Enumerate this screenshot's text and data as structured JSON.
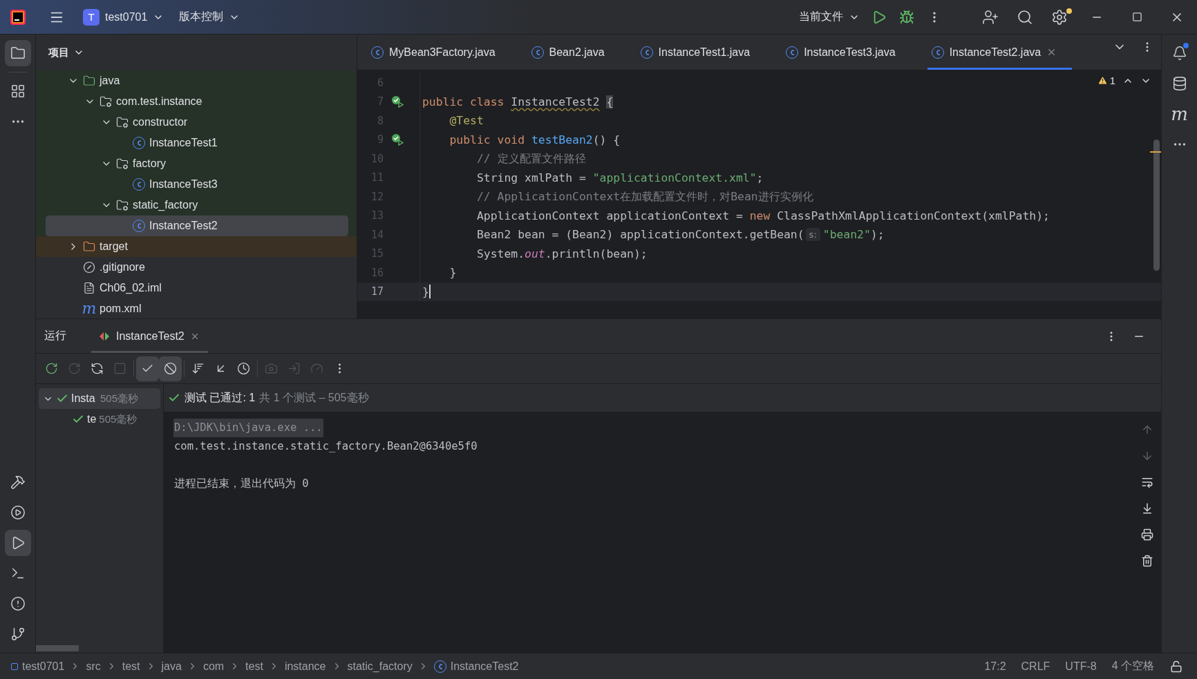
{
  "title_bar": {
    "project_initial": "T",
    "project": "test0701",
    "vcs": "版本控制",
    "run_config": "当前文件"
  },
  "left_tools": [
    {
      "kind": "project",
      "selected": true
    },
    {
      "kind": "structure",
      "selected": false
    },
    {
      "kind": "more",
      "selected": false
    }
  ],
  "left_tools_bottom": [
    {
      "kind": "build",
      "selected": false
    },
    {
      "kind": "services",
      "selected": false
    },
    {
      "kind": "run",
      "selected": true
    },
    {
      "kind": "terminal",
      "selected": false
    },
    {
      "kind": "problems",
      "selected": false
    },
    {
      "kind": "git",
      "selected": false
    }
  ],
  "right_tools": [
    {
      "kind": "notifications",
      "badge": true
    },
    {
      "kind": "database",
      "badge": false
    },
    {
      "kind": "maven",
      "label": "m",
      "badge": false
    },
    {
      "kind": "more",
      "badge": false
    }
  ],
  "project_panel": {
    "title": "项目",
    "tree": [
      {
        "name": "java",
        "kind": "test_folder",
        "expanded": true,
        "selected": false,
        "children": [
          {
            "name": "com.test.instance",
            "kind": "package",
            "expanded": true,
            "selected": false,
            "children": [
              {
                "name": "constructor",
                "kind": "package",
                "expanded": true,
                "selected": false,
                "children": [
                  {
                    "name": "InstanceTest1",
                    "kind": "class",
                    "selected": false
                  }
                ]
              },
              {
                "name": "factory",
                "kind": "package",
                "expanded": true,
                "selected": false,
                "children": [
                  {
                    "name": "InstanceTest3",
                    "kind": "class",
                    "selected": false
                  }
                ]
              },
              {
                "name": "static_factory",
                "kind": "package",
                "expanded": true,
                "selected": false,
                "children": [
                  {
                    "name": "InstanceTest2",
                    "kind": "class",
                    "selected": true
                  }
                ]
              }
            ]
          }
        ]
      },
      {
        "name": "target",
        "kind": "excluded_folder",
        "expanded": false,
        "selected": false
      },
      {
        "name": ".gitignore",
        "kind": "ignore_file",
        "selected": false
      },
      {
        "name": "Ch06_02.iml",
        "kind": "module_file",
        "selected": false
      },
      {
        "name": "pom.xml",
        "kind": "maven_file",
        "icon_label": "m",
        "selected": false
      }
    ]
  },
  "editor": {
    "tabs": [
      {
        "label": "MyBean3Factory.java",
        "selected": false,
        "closable": false
      },
      {
        "label": "Bean2.java",
        "selected": false,
        "closable": false
      },
      {
        "label": "InstanceTest1.java",
        "selected": false,
        "closable": false
      },
      {
        "label": "InstanceTest3.java",
        "selected": false,
        "closable": false
      },
      {
        "label": "InstanceTest2.java",
        "selected": true,
        "closable": true
      }
    ],
    "warnings": "1",
    "lines": [
      {
        "number": "6",
        "run": false,
        "current": false
      },
      {
        "number": "7",
        "run": true,
        "current": false,
        "segments": [
          {
            "kind": "keyword",
            "text": "public class "
          },
          {
            "kind": "class_name",
            "text": "InstanceTest2"
          },
          {
            "kind": "brace_match",
            "text": "{"
          }
        ]
      },
      {
        "number": "8",
        "run": false,
        "current": false,
        "segments": [
          {
            "kind": "annotation",
            "text": "    @Test"
          }
        ]
      },
      {
        "number": "9",
        "run": true,
        "current": false,
        "segments": [
          {
            "kind": "keyword",
            "text": "    public void "
          },
          {
            "kind": "method",
            "text": "testBean2"
          },
          {
            "kind": "plain",
            "text": "() {"
          }
        ]
      },
      {
        "number": "10",
        "run": false,
        "current": false,
        "segments": [
          {
            "kind": "comment",
            "text": "        // 定义配置文件路径"
          }
        ]
      },
      {
        "number": "11",
        "run": false,
        "current": false,
        "segments": [
          {
            "kind": "plain",
            "text": "        String xmlPath = "
          },
          {
            "kind": "string",
            "text": "\"applicationContext.xml\""
          },
          {
            "kind": "plain",
            "text": ";"
          }
        ]
      },
      {
        "number": "12",
        "run": false,
        "current": false,
        "segments": [
          {
            "kind": "comment",
            "text": "        // ApplicationContext在加载配置文件时，对Bean进行实例化"
          }
        ]
      },
      {
        "number": "13",
        "run": false,
        "current": false,
        "segments": [
          {
            "kind": "plain",
            "text": "        ApplicationContext applicationContext = "
          },
          {
            "kind": "keyword",
            "text": "new"
          },
          {
            "kind": "plain",
            "text": " ClassPathXmlApplicationContext(xmlPath);"
          }
        ]
      },
      {
        "number": "14",
        "run": false,
        "current": false,
        "segments": [
          {
            "kind": "plain",
            "text": "        Bean2 bean = (Bean2) applicationContext.getBean("
          },
          {
            "kind": "hint",
            "text": "s:"
          },
          {
            "kind": "string",
            "text": "\"bean2\""
          },
          {
            "kind": "plain",
            "text": ");"
          }
        ]
      },
      {
        "number": "15",
        "run": false,
        "current": false,
        "segments": [
          {
            "kind": "plain",
            "text": "        System."
          },
          {
            "kind": "field",
            "text": "out"
          },
          {
            "kind": "plain",
            "text": ".println(bean);"
          }
        ]
      },
      {
        "number": "16",
        "run": false,
        "current": false,
        "segments": [
          {
            "kind": "plain",
            "text": "    }"
          }
        ]
      },
      {
        "number": "17",
        "run": false,
        "current": true,
        "segments": [
          {
            "kind": "plain",
            "text": "}"
          }
        ]
      }
    ]
  },
  "run_panel": {
    "title": "运行",
    "tabs": [
      {
        "label": "InstanceTest2",
        "selected": true
      }
    ],
    "toolbar": [
      {
        "kind": "rerun",
        "on": false,
        "disabled": false
      },
      {
        "kind": "rerun_failed",
        "on": false,
        "disabled": true
      },
      {
        "kind": "toggle_auto",
        "on": false,
        "disabled": false
      },
      {
        "kind": "stop",
        "on": false,
        "disabled": true
      },
      {
        "kind": "show_passed",
        "on": true,
        "disabled": false
      },
      {
        "kind": "show_ignored",
        "on": true,
        "disabled": false
      },
      {
        "kind": "sort",
        "on": false,
        "disabled": false
      },
      {
        "kind": "collapse",
        "on": false,
        "disabled": false
      },
      {
        "kind": "history",
        "on": false,
        "disabled": false
      },
      {
        "kind": "camera",
        "on": false,
        "disabled": true
      },
      {
        "kind": "import",
        "on": false,
        "disabled": true
      },
      {
        "kind": "coverage",
        "on": false,
        "disabled": true
      },
      {
        "kind": "more",
        "on": false,
        "disabled": false
      }
    ],
    "test_tree": [
      {
        "name": "Insta",
        "time": "505毫秒",
        "expanded": true,
        "selected": true,
        "children": [
          {
            "name": "te",
            "time": "505毫秒",
            "selected": false
          }
        ]
      }
    ],
    "summary": {
      "status": "测试 已通过: 1",
      "detail": "共 1 个测试 – 505毫秒"
    },
    "console": [
      {
        "kind": "command",
        "text": "D:\\JDK\\bin\\java.exe ..."
      },
      {
        "kind": "output",
        "text": "com.test.instance.static_factory.Bean2@6340e5f0"
      },
      {
        "kind": "exit",
        "text": "进程已结束，退出代码为 0"
      }
    ]
  },
  "status_bar": {
    "breadcrumbs": [
      {
        "label": "test0701",
        "kind": "module"
      },
      {
        "label": "src",
        "kind": "folder"
      },
      {
        "label": "test",
        "kind": "folder"
      },
      {
        "label": "java",
        "kind": "folder"
      },
      {
        "label": "com",
        "kind": "folder"
      },
      {
        "label": "test",
        "kind": "folder"
      },
      {
        "label": "instance",
        "kind": "folder"
      },
      {
        "label": "static_factory",
        "kind": "folder"
      },
      {
        "label": "InstanceTest2",
        "kind": "class"
      }
    ],
    "position": "17:2",
    "line_separator": "CRLF",
    "encoding": "UTF-8",
    "indent": "4 个空格"
  }
}
